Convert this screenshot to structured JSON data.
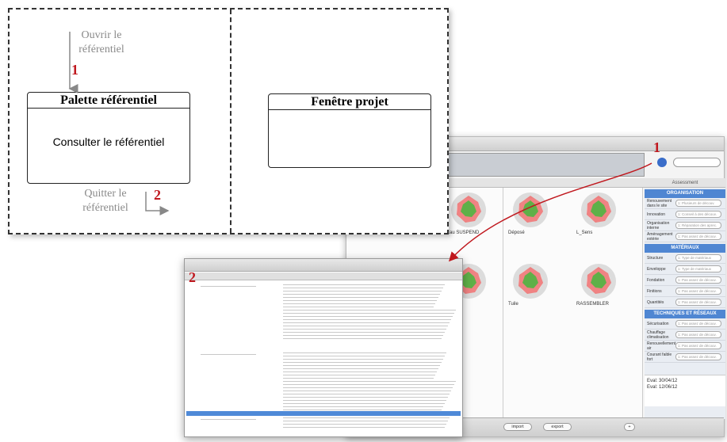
{
  "diagram": {
    "open_annotation_line1": "Ouvrir le",
    "open_annotation_line2": "référentiel",
    "step1": "1",
    "palette_title": "Palette référentiel",
    "palette_body": "Consulter le référentiel",
    "quit_annotation_line1": "Quitter le",
    "quit_annotation_line2": "référentiel",
    "step2": "2",
    "project_title": "Fenêtre projet"
  },
  "screenshot_markers": {
    "marker1": "1",
    "marker2": "2"
  },
  "colors": {
    "marker_red": "#c0181e",
    "section_blue": "#4f86d2",
    "radar_green": "#5fb048",
    "radar_red": "#ef6f6f"
  },
  "main_window": {
    "radars": [
      {
        "label": "Eau SUSPEND"
      },
      {
        "label": "Déposé"
      },
      {
        "label": "L_Sens"
      },
      {
        "label": ""
      },
      {
        "label": "Tuile"
      },
      {
        "label": "RASSEMBLER"
      }
    ],
    "assessment_header": "Assessment",
    "sections": [
      {
        "title": "ORGANISATION",
        "rows": [
          {
            "label": "Renouvement dans le site",
            "value": "1: Plusieurs de découv."
          },
          {
            "label": "Innovation",
            "value": "1: Conseil à des découv."
          },
          {
            "label": "Organisation interne",
            "value": "1: Réparation des aprec."
          },
          {
            "label": "Aménagement extérie",
            "value": "1: Pas assez de découv."
          }
        ]
      },
      {
        "title": "MATÉRIAUX",
        "rows": [
          {
            "label": "Structure",
            "value": "1: Type de matériaux"
          },
          {
            "label": "Enveloppe",
            "value": "1: Type de matériaux"
          },
          {
            "label": "Fondation",
            "value": "1: Pas assez de découv."
          },
          {
            "label": "Finitions",
            "value": "1: Pas assez de découv."
          },
          {
            "label": "Quantités",
            "value": "1: Pas assez de découv."
          }
        ]
      },
      {
        "title": "TECHNIQUES ET RÉSEAUX",
        "rows": [
          {
            "label": "Sécurisation",
            "value": "1: Pas assez de découv."
          },
          {
            "label": "Chauffage climatisation",
            "value": "1: Pas assez de découv."
          },
          {
            "label": "Renouvellement air",
            "value": "1: Pas assez de découv."
          },
          {
            "label": "Courant faible fort",
            "value": "1: Pas assez de découv."
          }
        ]
      }
    ],
    "date1": "Eval: 30/04/12",
    "date2": "Eval: 12/06/12",
    "import_label": "import",
    "export_label": "export"
  }
}
